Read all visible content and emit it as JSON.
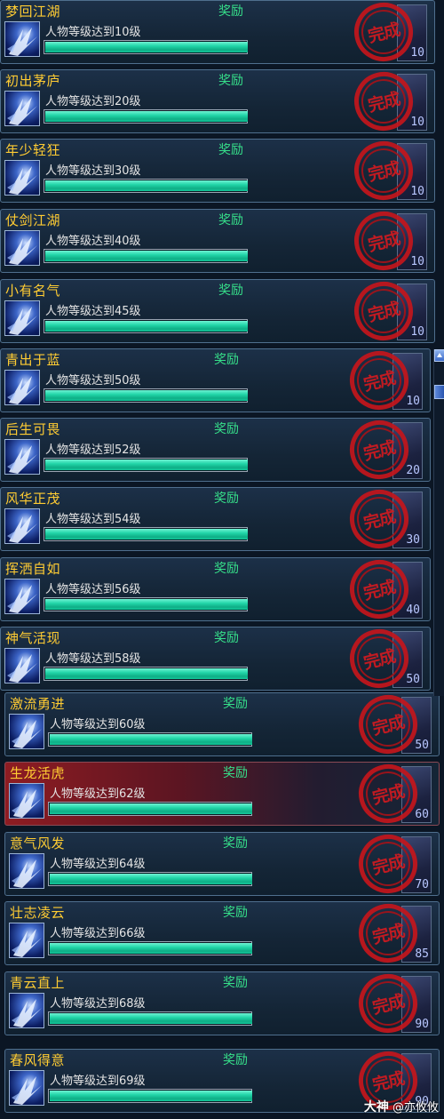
{
  "reward_label": "奖励",
  "stamp_text": "完成",
  "items": [
    {
      "title": "梦回江湖",
      "desc": "人物等级达到10级",
      "item_level": "10",
      "progress": 1.0,
      "selected": false
    },
    {
      "title": "初出茅庐",
      "desc": "人物等级达到20级",
      "item_level": "10",
      "progress": 1.0,
      "selected": false
    },
    {
      "title": "年少轻狂",
      "desc": "人物等级达到30级",
      "item_level": "10",
      "progress": 1.0,
      "selected": false
    },
    {
      "title": "仗剑江湖",
      "desc": "人物等级达到40级",
      "item_level": "10",
      "progress": 1.0,
      "selected": false
    },
    {
      "title": "小有名气",
      "desc": "人物等级达到45级",
      "item_level": "10",
      "progress": 1.0,
      "selected": false
    },
    {
      "title": "青出于蓝",
      "desc": "人物等级达到50级",
      "item_level": "10",
      "progress": 1.0,
      "selected": false
    },
    {
      "title": "后生可畏",
      "desc": "人物等级达到52级",
      "item_level": "20",
      "progress": 1.0,
      "selected": false
    },
    {
      "title": "风华正茂",
      "desc": "人物等级达到54级",
      "item_level": "30",
      "progress": 1.0,
      "selected": false
    },
    {
      "title": "挥洒自如",
      "desc": "人物等级达到56级",
      "item_level": "40",
      "progress": 1.0,
      "selected": false
    },
    {
      "title": "神气活现",
      "desc": "人物等级达到58级",
      "item_level": "50",
      "progress": 1.0,
      "selected": false
    },
    {
      "title": "激流勇进",
      "desc": "人物等级达到60级",
      "item_level": "50",
      "progress": 1.0,
      "selected": false
    },
    {
      "title": "生龙活虎",
      "desc": "人物等级达到62级",
      "item_level": "60",
      "progress": 1.0,
      "selected": true
    },
    {
      "title": "意气风发",
      "desc": "人物等级达到64级",
      "item_level": "70",
      "progress": 1.0,
      "selected": false
    },
    {
      "title": "壮志凌云",
      "desc": "人物等级达到66级",
      "item_level": "85",
      "progress": 1.0,
      "selected": false
    },
    {
      "title": "青云直上",
      "desc": "人物等级达到68级",
      "item_level": "90",
      "progress": 1.0,
      "selected": false
    },
    {
      "title": "春风得意",
      "desc": "人物等级达到69级",
      "item_level": "90",
      "progress": 1.0,
      "selected": false
    }
  ],
  "watermark": {
    "brand": "大神",
    "user": "@亦攸攸"
  },
  "colors": {
    "title": "#ffcc33",
    "reward": "#36e08a",
    "stamp": "#c4161c",
    "bar": "#21d5a8",
    "selected_row": "#8e1c22"
  }
}
